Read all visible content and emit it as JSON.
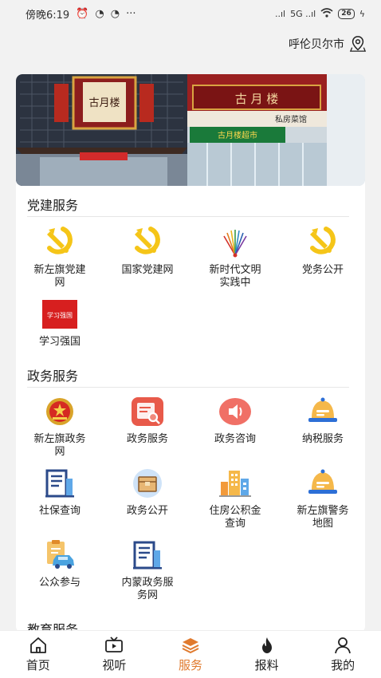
{
  "status_bar": {
    "time": "傍晚6:19",
    "more": "···",
    "signal1": "..ıl",
    "signal2": "5G ..ıl",
    "battery": "26"
  },
  "location": {
    "city": "呼伦贝尔市"
  },
  "banner": {
    "sign_main": "古月楼",
    "sign_top": "古 月 楼",
    "sign_sub": "私房菜馆",
    "sign_shop": "古月楼超市"
  },
  "sections": {
    "party": {
      "title": "党建服务",
      "items": [
        {
          "label": "新左旗党建网"
        },
        {
          "label": "国家党建网"
        },
        {
          "label": "新时代文明实践中"
        },
        {
          "label": "党务公开"
        },
        {
          "label": "学习强国"
        }
      ]
    },
    "gov": {
      "title": "政务服务",
      "items": [
        {
          "label": "新左旗政务网"
        },
        {
          "label": "政务服务"
        },
        {
          "label": "政务咨询"
        },
        {
          "label": "纳税服务"
        },
        {
          "label": "社保查询"
        },
        {
          "label": "政务公开"
        },
        {
          "label": "住房公积金查询"
        },
        {
          "label": "新左旗警务地图"
        },
        {
          "label": "公众参与"
        },
        {
          "label": "内蒙政务服务网"
        }
      ]
    },
    "edu": {
      "title": "教育服务"
    }
  },
  "xuexi_logo_text": "学习强国",
  "nav": {
    "items": [
      {
        "label": "首页"
      },
      {
        "label": "视听"
      },
      {
        "label": "服务"
      },
      {
        "label": "报料"
      },
      {
        "label": "我的"
      }
    ],
    "active_color": "#e07a2e"
  },
  "colors": {
    "party_red": "#e8231b",
    "party_yellow": "#f5c518",
    "orange": "#e07a2e",
    "blue": "#2d6fd6"
  }
}
